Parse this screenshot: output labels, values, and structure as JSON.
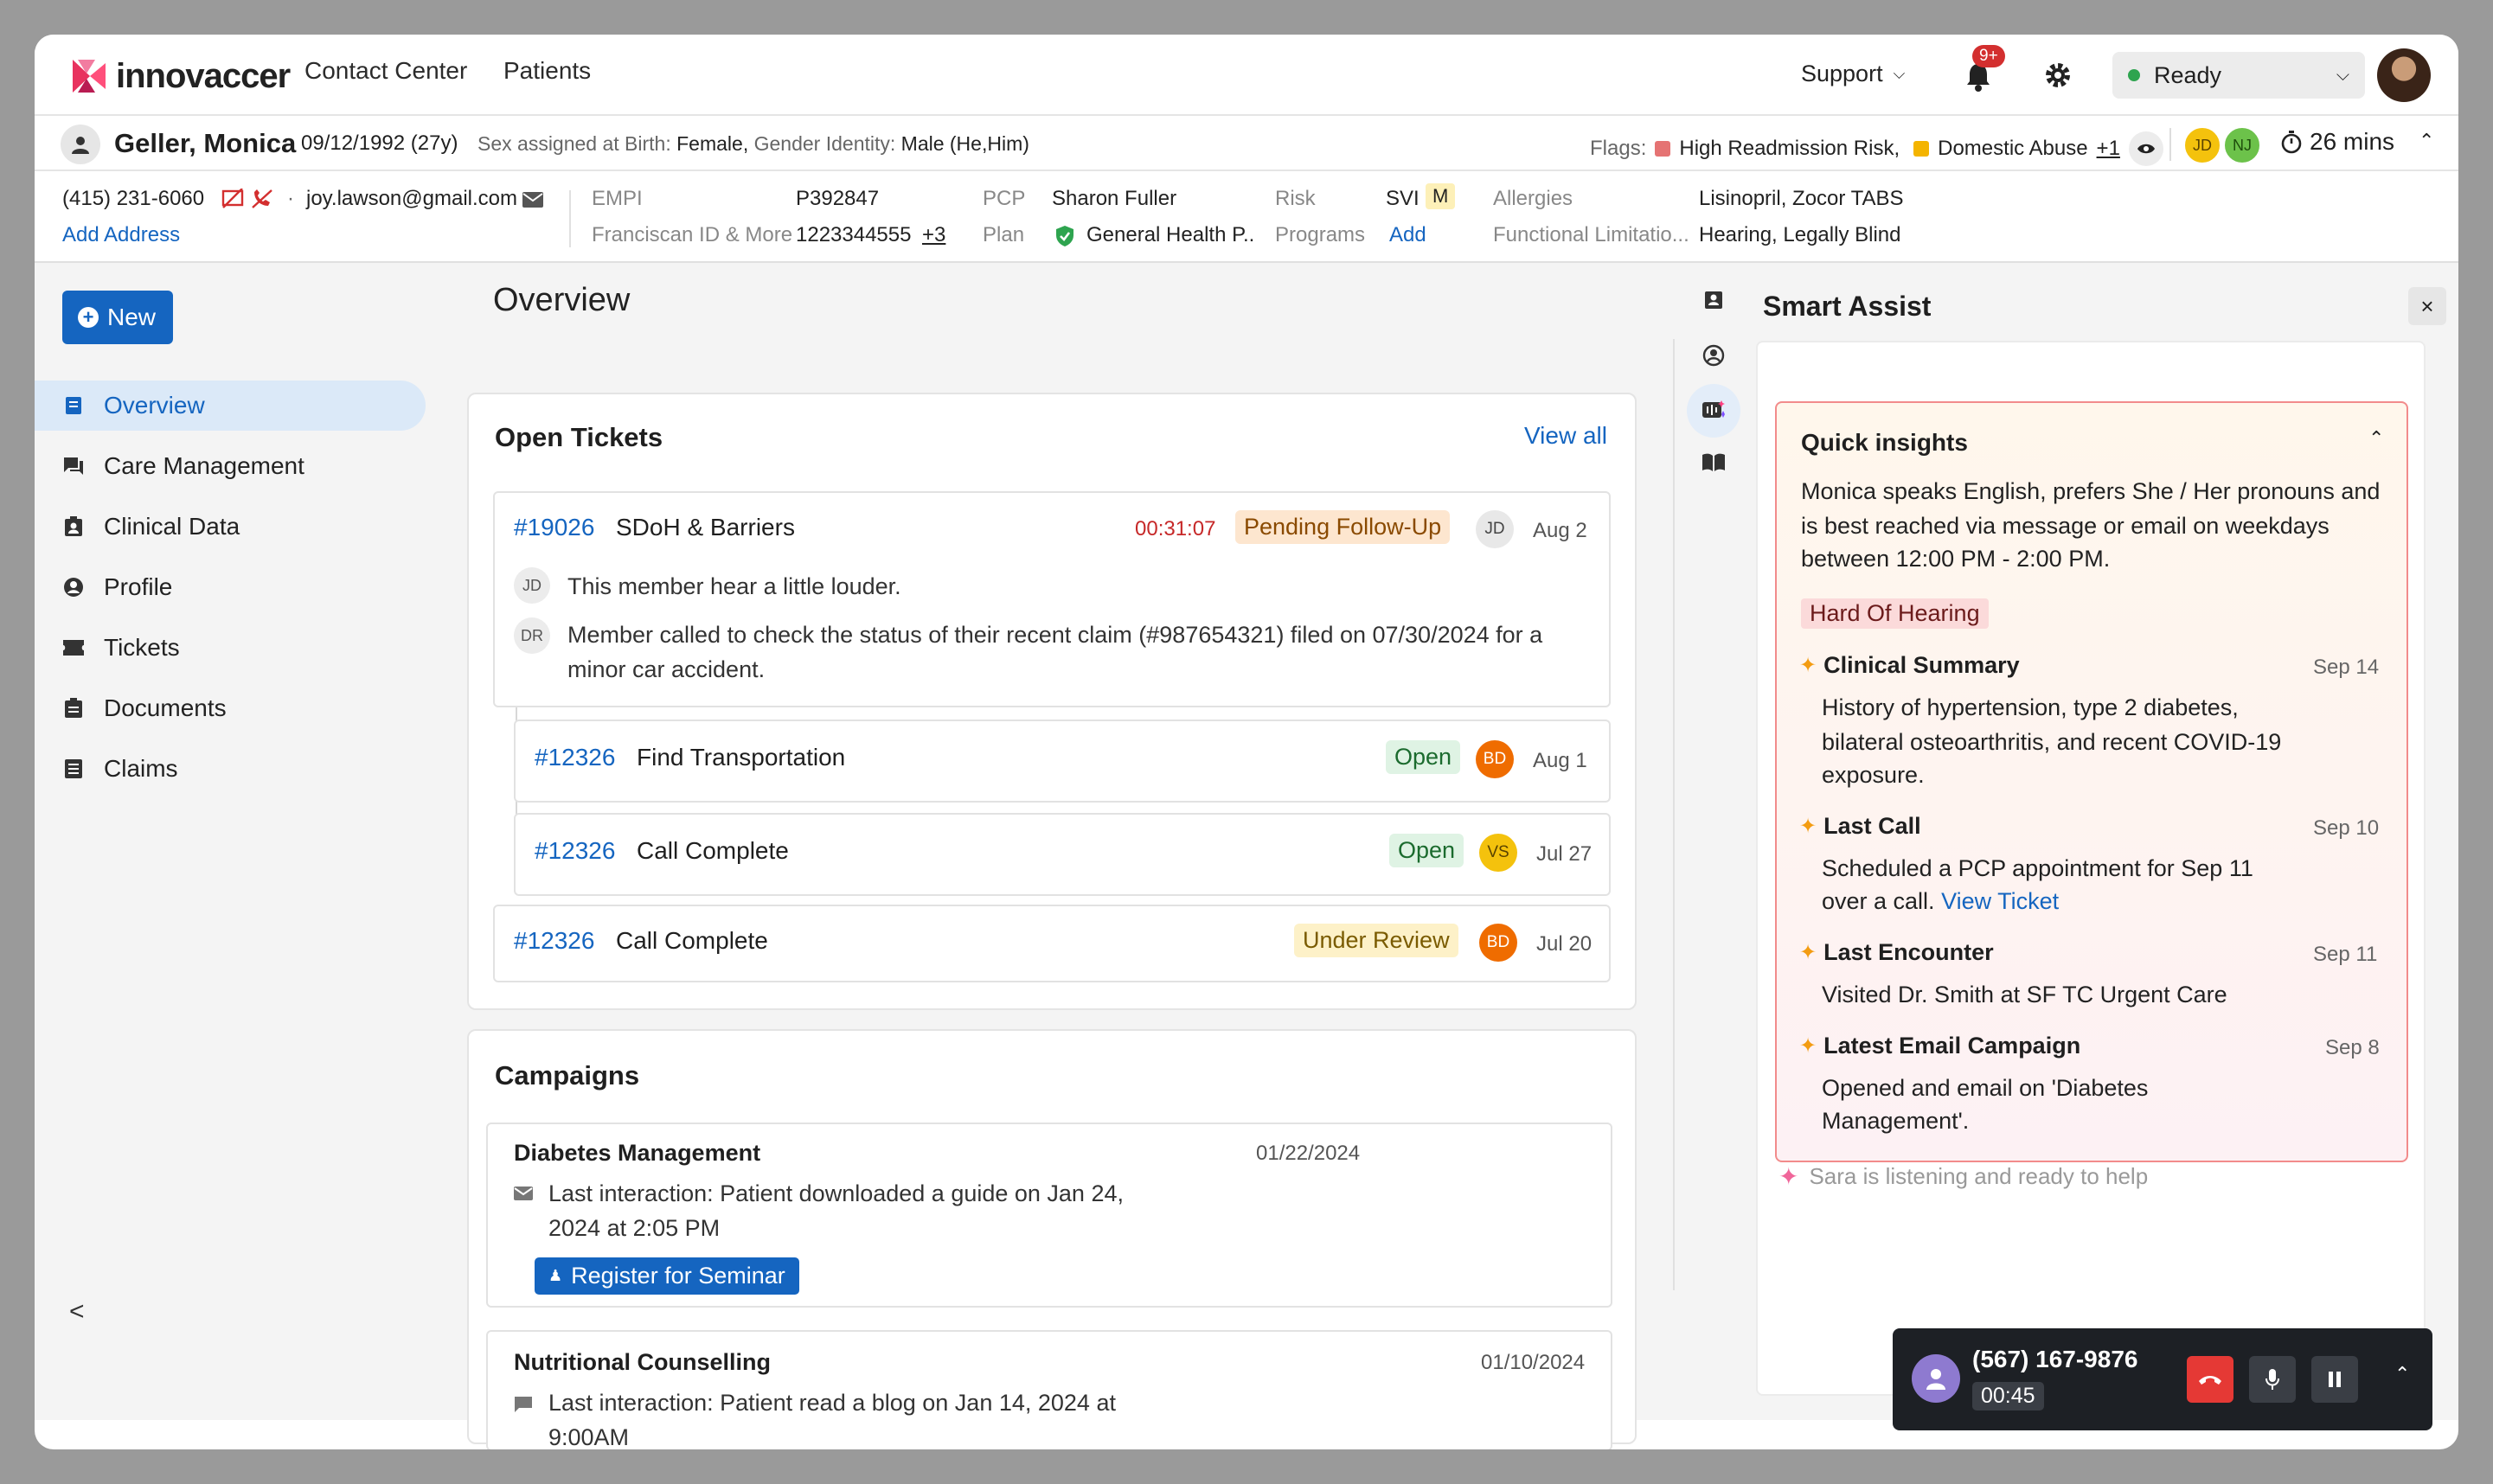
{
  "header": {
    "logo_text": "innovaccer",
    "nav": [
      "Contact Center",
      "Patients"
    ],
    "support_label": "Support",
    "notification_count": "9+",
    "status_label": "Ready"
  },
  "patient": {
    "name": "Geller, Monica",
    "dob": "09/12/1992 (27y)",
    "sex_label": "Sex assigned at Birth:",
    "sex_value": "Female,",
    "gender_label": "Gender Identity:",
    "gender_value": "Male (He,Him)",
    "flags_label": "Flags:",
    "flag1": "High Readmission Risk,",
    "flag2": "Domestic Abuse",
    "flag_more": "+1",
    "assignees": [
      "JD",
      "NJ"
    ],
    "timer": "26 mins"
  },
  "info": {
    "phone": "(415) 231-6060",
    "email": "joy.lawson@gmail.com",
    "add_address": "Add Address",
    "empi_label": "EMPI",
    "empi_value": "P392847",
    "fid_label": "Franciscan ID & More",
    "fid_value": "1223344555",
    "fid_more": "+3",
    "pcp_label": "PCP",
    "pcp_value": "Sharon Fuller",
    "plan_label": "Plan",
    "plan_value": "General Health P..",
    "risk_label": "Risk",
    "risk_value": "SVI",
    "risk_level": "M",
    "programs_label": "Programs",
    "programs_add": "Add",
    "allergies_label": "Allergies",
    "allergies_value": "Lisinopril, Zocor TABS",
    "functional_label": "Functional Limitatio...",
    "functional_value": "Hearing, Legally Blind"
  },
  "sidebar": {
    "new_label": "New",
    "items": [
      "Overview",
      "Care Management",
      "Clinical Data",
      "Profile",
      "Tickets",
      "Documents",
      "Claims"
    ],
    "collapse": "<"
  },
  "main": {
    "title": "Overview",
    "tickets_title": "Open Tickets",
    "view_all": "View all",
    "tickets": [
      {
        "id": "#19026",
        "name": "SDoH & Barriers",
        "timer": "00:31:07",
        "status": "Pending Follow-Up",
        "assignee": "JD",
        "date": "Aug 2"
      },
      {
        "id": "#12326",
        "name": "Find Transportation",
        "status": "Open",
        "assignee": "BD",
        "date": "Aug 1"
      },
      {
        "id": "#12326",
        "name": "Call Complete",
        "status": "Open",
        "assignee": "VS",
        "date": "Jul 27"
      },
      {
        "id": "#12326",
        "name": "Call Complete",
        "status": "Under Review",
        "assignee": "BD",
        "date": "Jul 20"
      }
    ],
    "comments": [
      {
        "author": "JD",
        "text": "This member hear a little louder."
      },
      {
        "author": "DR",
        "text": "Member called to check the status of their recent claim (#987654321) filed on 07/30/2024 for a minor car accident."
      }
    ],
    "campaigns_title": "Campaigns",
    "campaigns": [
      {
        "name": "Diabetes Management",
        "date": "01/22/2024",
        "text": "Last interaction: Patient downloaded a guide on Jan 24, 2024 at 2:05 PM",
        "action": "Register for Seminar"
      },
      {
        "name": "Nutritional Counselling",
        "date": "01/10/2024",
        "text": "Last interaction: Patient read a blog on Jan 14, 2024 at 9:00AM"
      }
    ]
  },
  "assist": {
    "title": "Smart Assist",
    "insights_title": "Quick insights",
    "summary_lines": [
      "Monica speaks English, prefers She / Her pronouns and",
      "is best reached via message or email on weekdays",
      "between 12:00 PM - 2:00 PM."
    ],
    "tag": "Hard Of Hearing",
    "insights": [
      {
        "title": "Clinical Summary",
        "date": "Sep 14",
        "lines": [
          "History of hypertension, type 2 diabetes,",
          "bilateral osteoarthritis, and recent COVID-19",
          "exposure."
        ]
      },
      {
        "title": "Last Call",
        "date": "Sep 10",
        "lines": [
          "Scheduled a PCP appointment for Sep 11",
          "over a call."
        ],
        "link": "View Ticket"
      },
      {
        "title": "Last Encounter",
        "date": "Sep 11",
        "lines": [
          "Visited Dr. Smith at SF TC Urgent Care"
        ]
      },
      {
        "title": "Latest Email Campaign",
        "date": "Sep 8",
        "lines": [
          "Opened and email on 'Diabetes",
          "Management'."
        ]
      }
    ],
    "listening": "Sara is listening and ready to help"
  },
  "call": {
    "number": "(567) 167-9876",
    "duration": "00:45"
  },
  "colors": {
    "brand": "#1565c0",
    "flag_high": "#e57373",
    "flag_abuse": "#f4b400",
    "end_call": "#e53935"
  }
}
